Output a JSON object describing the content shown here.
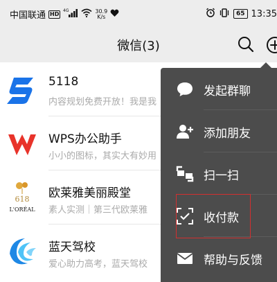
{
  "status_bar": {
    "carrier": "中国联通",
    "hd": "HD",
    "network": "4G",
    "speed_value": "30.9",
    "speed_unit": "K/s",
    "battery": "65",
    "time": "13:35"
  },
  "header": {
    "title": "微信(3)"
  },
  "chats": [
    {
      "name": "5118",
      "preview": "内容规划免费开放！我是我",
      "avatar_icon": "5118-logo-icon"
    },
    {
      "name": "WPS办公助手",
      "preview": "小小的图标，其实大有妙用",
      "avatar_icon": "wps-logo-icon"
    },
    {
      "name": "欧莱雅美丽殿堂",
      "preview": "素人实测｜第三代欧莱雅",
      "avatar_icon": "loreal-618-logo-icon",
      "avatar_text_top": "618",
      "avatar_text_bottom": "L'ORÉAL"
    },
    {
      "name": "蓝天驾校",
      "preview": "爱心助力高考，蓝天驾校",
      "avatar_icon": "lantian-logo-icon"
    }
  ],
  "menu": {
    "items": [
      {
        "label": "发起群聊",
        "icon": "chat-bubble-icon"
      },
      {
        "label": "添加朋友",
        "icon": "add-friend-icon"
      },
      {
        "label": "扫一扫",
        "icon": "scan-icon"
      },
      {
        "label": "收付款",
        "icon": "payment-icon"
      },
      {
        "label": "帮助与反馈",
        "icon": "mail-icon"
      }
    ]
  },
  "colors": {
    "menu_bg": "#4c4c4c",
    "highlight": "#d32f2f",
    "bar_bg": "#ededed"
  }
}
